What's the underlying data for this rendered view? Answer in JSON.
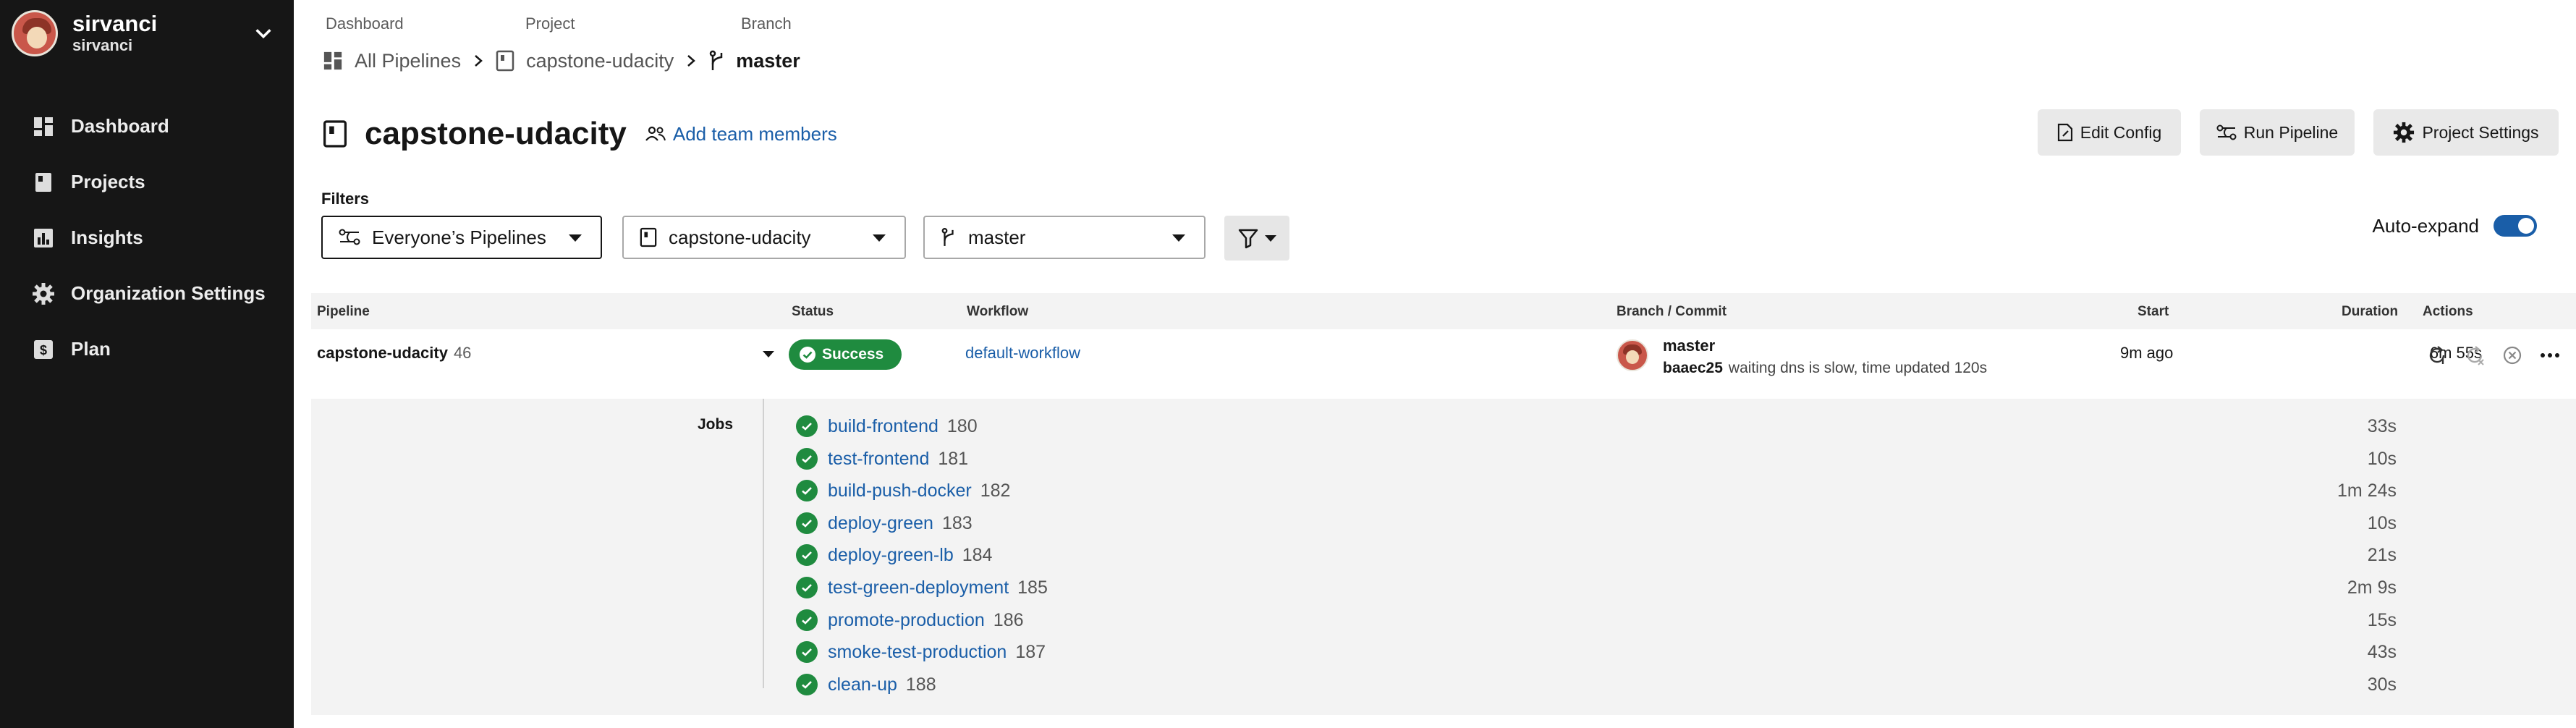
{
  "sidebar": {
    "org_name": "sirvanci",
    "org_sub": "sirvanci",
    "items": [
      {
        "label": "Dashboard",
        "icon": "dashboard-icon"
      },
      {
        "label": "Projects",
        "icon": "projects-icon"
      },
      {
        "label": "Insights",
        "icon": "insights-icon"
      },
      {
        "label": "Organization Settings",
        "icon": "gear-icon"
      },
      {
        "label": "Plan",
        "icon": "plan-icon"
      }
    ]
  },
  "breadcrumb": {
    "labels": [
      "Dashboard",
      "Project",
      "Branch"
    ],
    "all_pipelines": "All Pipelines",
    "project": "capstone-udacity",
    "branch": "master"
  },
  "header": {
    "title": "capstone-udacity",
    "add_team": "Add team members",
    "edit_config": "Edit Config",
    "run_pipeline": "Run Pipeline",
    "project_settings": "Project Settings"
  },
  "filters": {
    "label": "Filters",
    "pipelines": "Everyone’s Pipelines",
    "project": "capstone-udacity",
    "branch": "master",
    "auto_expand_label": "Auto-expand",
    "auto_expand_on": true
  },
  "table": {
    "headers": [
      "Pipeline",
      "Status",
      "Workflow",
      "Branch / Commit",
      "Start",
      "Duration",
      "Actions"
    ],
    "row": {
      "pipeline": "capstone-udacity",
      "number": "46",
      "status": "Success",
      "workflow": "default-workflow",
      "branch": "master",
      "sha": "baaec25",
      "message": "waiting dns is slow, time updated 120s",
      "start": "9m ago",
      "duration": "6m 55s"
    }
  },
  "jobs": {
    "label": "Jobs",
    "items": [
      {
        "name": "build-frontend",
        "num": "180",
        "duration": "33s"
      },
      {
        "name": "test-frontend",
        "num": "181",
        "duration": "10s"
      },
      {
        "name": "build-push-docker",
        "num": "182",
        "duration": "1m 24s"
      },
      {
        "name": "deploy-green",
        "num": "183",
        "duration": "10s"
      },
      {
        "name": "deploy-green-lb",
        "num": "184",
        "duration": "21s"
      },
      {
        "name": "test-green-deployment",
        "num": "185",
        "duration": "2m 9s"
      },
      {
        "name": "promote-production",
        "num": "186",
        "duration": "15s"
      },
      {
        "name": "smoke-test-production",
        "num": "187",
        "duration": "43s"
      },
      {
        "name": "clean-up",
        "num": "188",
        "duration": "30s"
      }
    ]
  },
  "colors": {
    "sidebar_bg": "#161616",
    "link": "#1a5ea8",
    "success": "#1f8b3f",
    "table_header_bg": "#f3f3f3"
  }
}
